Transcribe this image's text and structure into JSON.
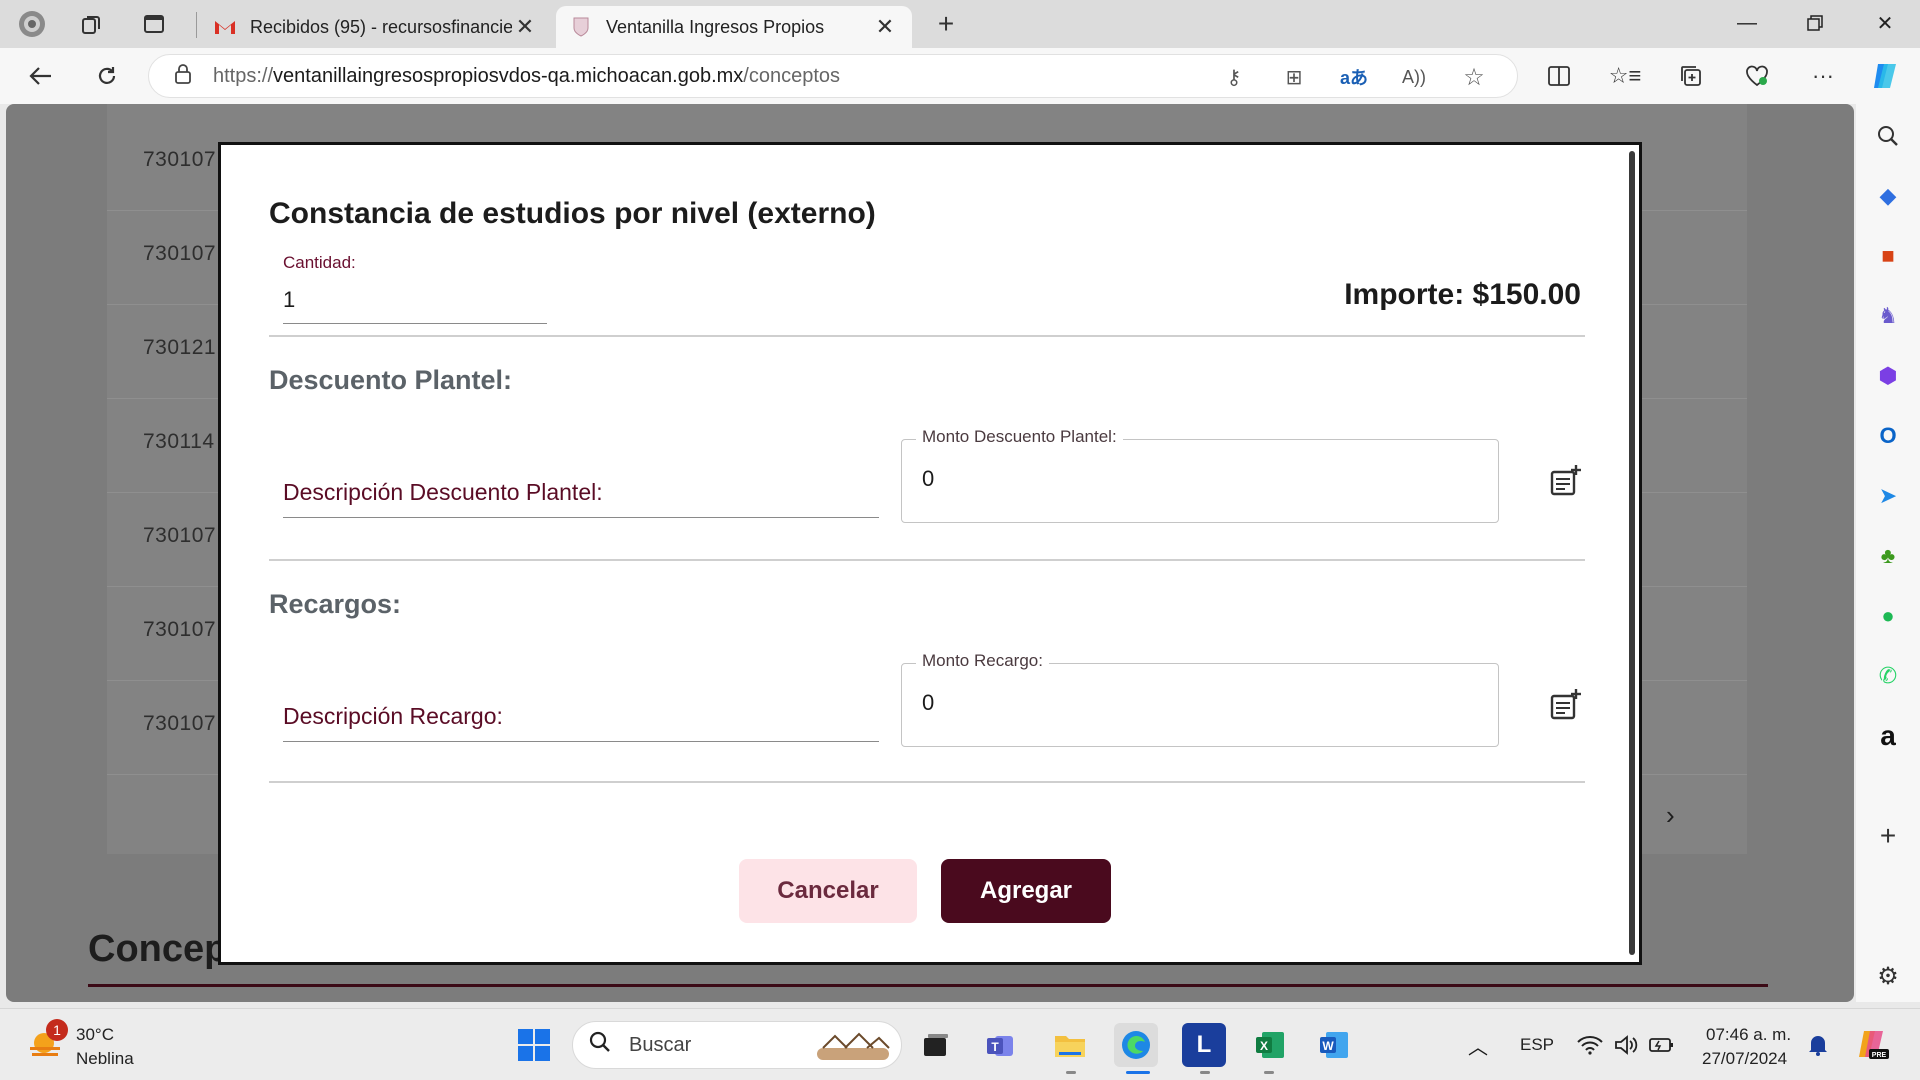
{
  "browser": {
    "tabs": [
      {
        "title": "Recibidos (95) - recursosfinancier",
        "favicon": "gmail-icon",
        "active": false
      },
      {
        "title": "Ventanilla Ingresos Propios",
        "favicon": "site-crest-icon",
        "active": true
      }
    ],
    "url_prefix": "https://",
    "url_host": "ventanillaingresospropiosvdos-qa.michoacan.gob.mx",
    "url_path": "/conceptos"
  },
  "background": {
    "row_codes": [
      "730107",
      "730107",
      "730121",
      "730114",
      "730107",
      "730107",
      "730107"
    ],
    "heading_fragment": "Concep"
  },
  "modal": {
    "title": "Constancia de estudios por nivel (externo)",
    "quantity_label": "Cantidad:",
    "quantity_value": "1",
    "importe": "Importe: $150.00",
    "discount_section": "Descuento Plantel:",
    "discount_desc_label": "Descripción Descuento Plantel:",
    "discount_amount_label": "Monto Descuento Plantel:",
    "discount_amount_value": "0",
    "surcharge_section": "Recargos:",
    "surcharge_desc_label": "Descripción Recargo:",
    "surcharge_amount_label": "Monto Recargo:",
    "surcharge_amount_value": "0",
    "cancel_label": "Cancelar",
    "add_label": "Agregar"
  },
  "taskbar": {
    "weather_temp": "30°C",
    "weather_desc": "Neblina",
    "weather_badge": "1",
    "search_placeholder": "Buscar",
    "language": "ESP",
    "time": "07:46 a. m.",
    "date": "27/07/2024"
  },
  "colors": {
    "brand_dark": "#4a0a1e",
    "brand_light": "#fde3e7",
    "label": "#6a1030"
  }
}
